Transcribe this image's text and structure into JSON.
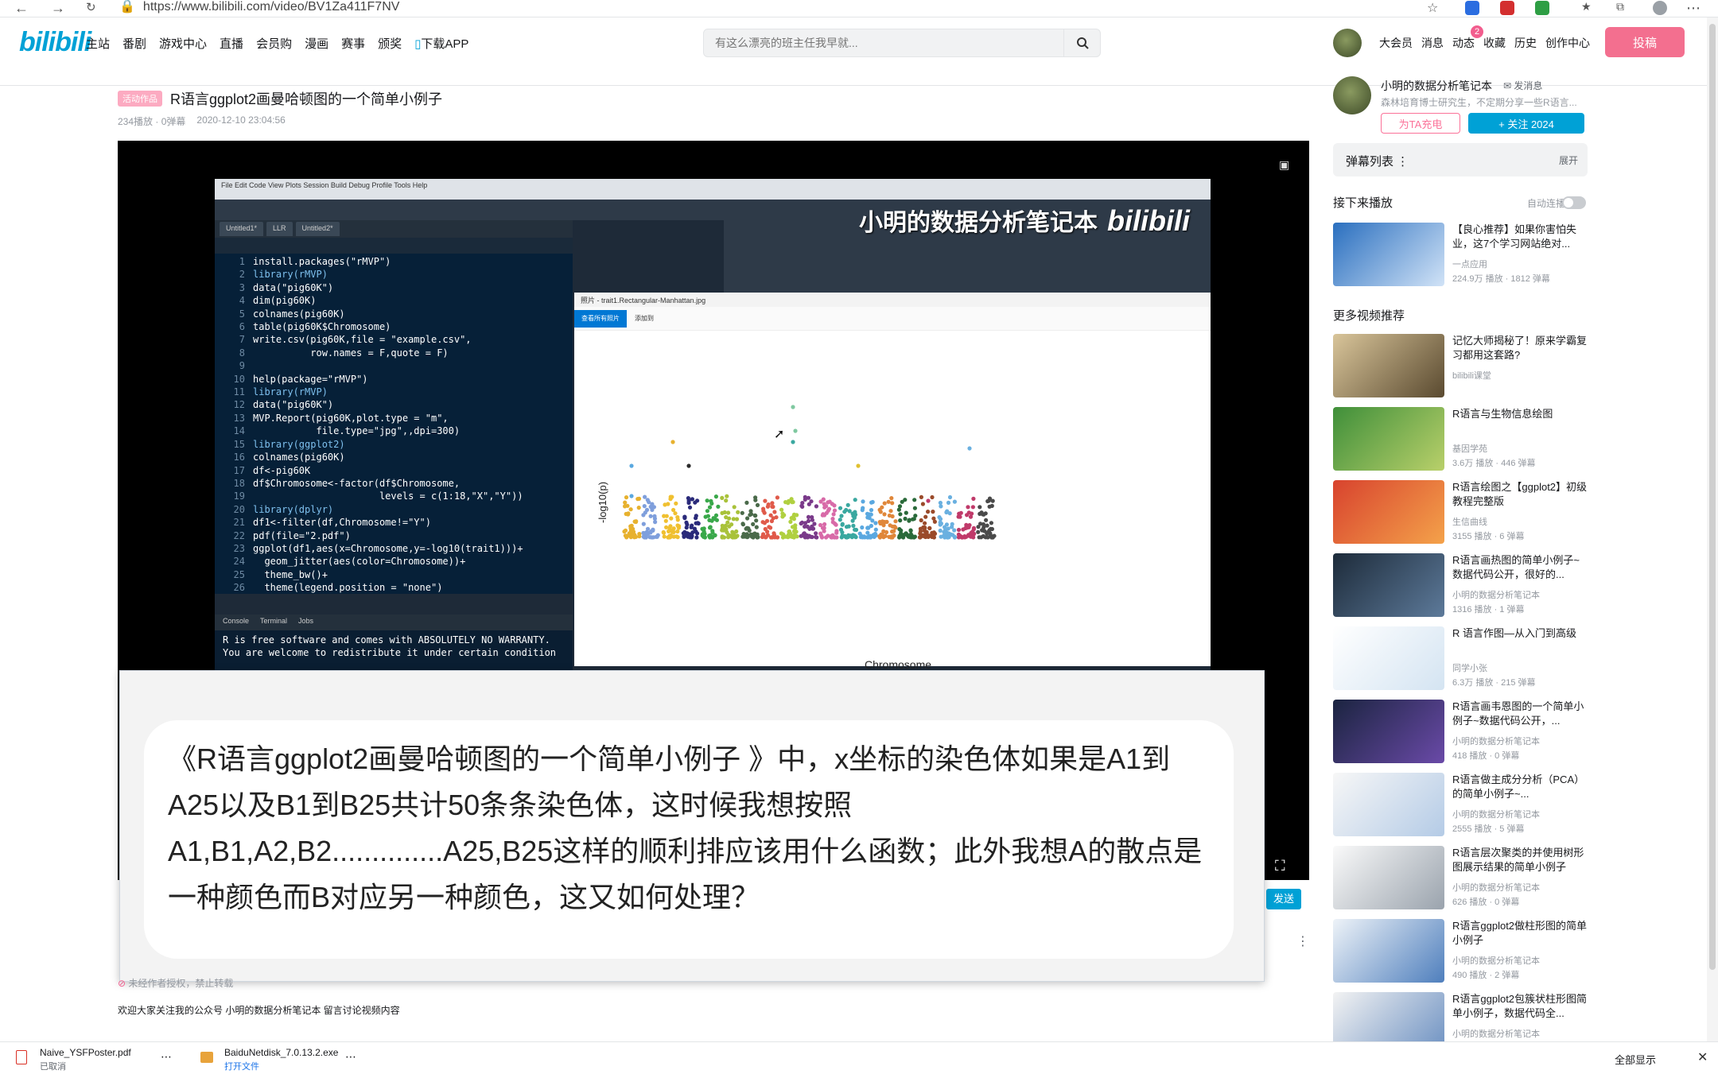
{
  "browser": {
    "url": "https://www.bilibili.com/video/BV1Za411F7NV"
  },
  "header": {
    "logo": "bilibili",
    "nav": [
      "主站",
      "番剧",
      "游戏中心",
      "直播",
      "会员购",
      "漫画",
      "赛事",
      "颁奖",
      "下载APP"
    ],
    "search_placeholder": "有这么漂亮的班主任我早就...",
    "right": [
      "大会员",
      "消息",
      "动态",
      "收藏",
      "历史",
      "创作中心"
    ],
    "badge": "2",
    "upload": "投稿"
  },
  "video": {
    "tag": "活动作品",
    "title": "R语言ggplot2画曼哈顿图的一个简单小例子",
    "plays": "234播放",
    "danmaku": "0弹幕",
    "date": "2020-12-10 23:04:56"
  },
  "player": {
    "watermark": "小明的数据分析笔记本",
    "watermark_brand": "bilibili",
    "rstudio_menu": "File  Edit  Code  View  Plots  Session  Build  Debug  Profile  Tools  Help",
    "tabs": [
      "Untitled1*",
      "LLR",
      "Untitled2*"
    ],
    "code": [
      "install.packages(\"rMVP\")",
      "library(rMVP)",
      "data(\"pig60K\")",
      "dim(pig60K)",
      "colnames(pig60K)",
      "table(pig60K$Chromosome)",
      "write.csv(pig60K,file = \"example.csv\",",
      "          row.names = F,quote = F)",
      "",
      "help(package=\"rMVP\")",
      "library(rMVP)",
      "data(\"pig60K\")",
      "MVP.Report(pig60K,plot.type = \"m\",",
      "           file.type=\"jpg\",,dpi=300)",
      "library(ggplot2)",
      "colnames(pig60K)",
      "df<-pig60K",
      "df$Chromosome<-factor(df$Chromosome,",
      "                      levels = c(1:18,\"X\",\"Y\"))",
      "library(dplyr)",
      "df1<-filter(df,Chromosome!=\"Y\")",
      "pdf(file=\"2.pdf\")",
      "ggplot(df1,aes(x=Chromosome,y=-log10(trait1)))+",
      "  geom_jitter(aes(color=Chromosome))+",
      "  theme_bw()+",
      "  theme(legend.position = \"none\")"
    ],
    "console_tabs": [
      "Console",
      "Terminal",
      "Jobs"
    ],
    "console_lines": [
      "R is free software and comes with ABSOLUTELY NO WARRANTY.",
      "You are welcome to redistribute it under certain condition"
    ],
    "photo_title": "照片 - trait1.Rectangular-Manhattan.jpg",
    "photo_button": "查看所有照片",
    "photo_add": "添加到",
    "ylabel": "-log10(p)",
    "xlabel": "Chromosome",
    "send": "发送"
  },
  "question": "《R语言ggplot2画曼哈顿图的一个简单小例子 》中，x坐标的染色体如果是A1到A25以及B1到B25共计50条条染色体，这时候我想按照A1,B1,A2,B2..............A25,B25这样的顺利排应该用什么函数；此外我想A的散点是一种颜色而B对应另一种颜色，这又如何处理？",
  "below": {
    "notice": "未经作者授权，禁止转载",
    "desc": "欢迎大家关注我的公众号 小明的数据分析笔记本 留言讨论视频内容"
  },
  "sidebar": {
    "up_name": "小明的数据分析笔记本",
    "up_msg": "发消息",
    "up_desc": "森林培育博士研究生，不定期分享一些R语言...",
    "charge": "为TA充电",
    "follow": "+ 关注 2024",
    "danmu_title": "弹幕列表",
    "danmu_expand": "展开",
    "next_title": "接下来播放",
    "autoplay": "自动连播",
    "more_title": "更多视频推荐",
    "next": {
      "title": "【良心推荐】如果你害怕失业，这7个学习网站绝对...",
      "author": "一点应用",
      "stats": "224.9万 播放 · 1812 弹幕"
    },
    "recs": [
      {
        "title": "记忆大师揭秘了！原来学霸复习都用这套路?",
        "author": "bilibili课堂",
        "stats": ""
      },
      {
        "title": "R语言与生物信息绘图",
        "author": "基因学苑",
        "stats": "3.6万 播放 · 446 弹幕"
      },
      {
        "title": "R语言绘图之【ggplot2】初级教程完整版",
        "author": "生信曲线",
        "stats": "3155 播放 · 6 弹幕"
      },
      {
        "title": "R语言画热图的简单小例子~数据代码公开，很好的...",
        "author": "小明的数据分析笔记本",
        "stats": "1316 播放 · 1 弹幕"
      },
      {
        "title": "R 语言作图—从入门到高级",
        "author": "同学小张",
        "stats": "6.3万 播放 · 215 弹幕"
      },
      {
        "title": "R语言画韦恩图的一个简单小例子~数据代码公开，...",
        "author": "小明的数据分析笔记本",
        "stats": "418 播放 · 0 弹幕"
      },
      {
        "title": "R语言做主成分分析（PCA）的简单小例子~...",
        "author": "小明的数据分析笔记本",
        "stats": "2555 播放 · 5 弹幕"
      },
      {
        "title": "R语言层次聚类的并使用树形图展示结果的简单小例子",
        "author": "小明的数据分析笔记本",
        "stats": "626 播放 · 0 弹幕"
      },
      {
        "title": "R语言ggplot2做柱形图的简单小例子",
        "author": "小明的数据分析笔记本",
        "stats": "490 播放 · 2 弹幕"
      },
      {
        "title": "R语言ggplot2包簇状柱形图简单小例子，数据代码全...",
        "author": "小明的数据分析笔记本",
        "stats": ""
      }
    ]
  },
  "downloads": [
    {
      "name": "Naive_YSFPoster.pdf",
      "status": "已取消"
    },
    {
      "name": "BaiduNetdisk_7.0.13.2.exe",
      "status": "打开文件"
    }
  ],
  "show_all": "全部显示",
  "colors": {
    "brand": "#00a1d6",
    "pink": "#fb7299",
    "upload": "#f36f8f"
  }
}
